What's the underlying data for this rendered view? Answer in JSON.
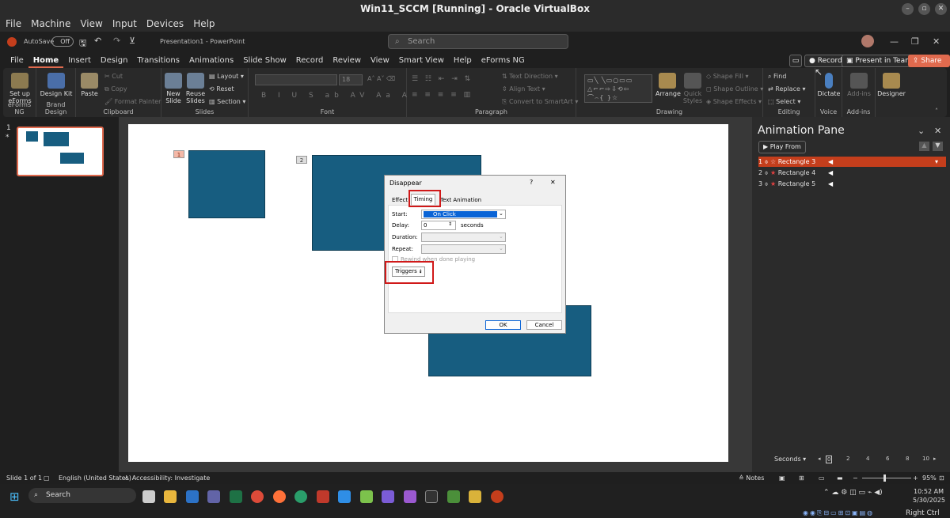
{
  "window": {
    "title": "Win11_SCCM [Running] - Oracle VirtualBox"
  },
  "vb_menu": [
    "File",
    "Machine",
    "View",
    "Input",
    "Devices",
    "Help"
  ],
  "qat": {
    "autosave": "AutoSave",
    "toggle": "Off",
    "doc_title": "Presentation1 - PowerPoint",
    "search_placeholder": "Search"
  },
  "tabs": [
    "File",
    "Home",
    "Insert",
    "Design",
    "Transitions",
    "Animations",
    "Slide Show",
    "Record",
    "Review",
    "View",
    "Smart View",
    "Help",
    "eForms NG"
  ],
  "header_buttons": {
    "record": "Record",
    "present": "Present in Teams",
    "share": "Share"
  },
  "ribbon": {
    "setup": "Set up eForms",
    "design_kit": "Design Kit",
    "g_eforms": "eForms NG",
    "g_brand": "Brand Design",
    "paste": "Paste",
    "cut": "Cut",
    "copy": "Copy",
    "format_painter": "Format Painter",
    "g_clipboard": "Clipboard",
    "new_slide": "New Slide",
    "reuse": "Reuse Slides",
    "layout": "Layout",
    "reset": "Reset",
    "section": "Section",
    "g_slides": "Slides",
    "font_size": "18",
    "g_font": "Font",
    "text_direction": "Text Direction",
    "align_text": "Align Text",
    "convert_smartart": "Convert to SmartArt",
    "g_paragraph": "Paragraph",
    "arrange": "Arrange",
    "quick_styles": "Quick Styles",
    "shape_fill": "Shape Fill",
    "shape_outline": "Shape Outline",
    "shape_effects": "Shape Effects",
    "g_drawing": "Drawing",
    "find": "Find",
    "replace": "Replace",
    "select": "Select",
    "g_editing": "Editing",
    "dictate": "Dictate",
    "g_voice": "Voice",
    "addins": "Add-ins",
    "g_addins": "Add-ins",
    "designer": "Designer"
  },
  "thumb": {
    "number": "1",
    "star": "*"
  },
  "slide": {
    "tag1": "1",
    "tag2": "2"
  },
  "animation_pane": {
    "title": "Animation Pane",
    "play_from": "Play From",
    "items": [
      {
        "num": "1",
        "label": "Rectangle 3"
      },
      {
        "num": "2",
        "label": "Rectangle 4"
      },
      {
        "num": "3",
        "label": "Rectangle 5"
      }
    ],
    "seconds": "Seconds",
    "timeline": [
      "0",
      "2",
      "4",
      "6",
      "8",
      "10"
    ]
  },
  "dialog": {
    "title": "Disappear",
    "help": "?",
    "close": "✕",
    "tabs": [
      "Effect",
      "Timing",
      "Text Animation"
    ],
    "start_label": "Start:",
    "start_value": "On Click",
    "delay_label": "Delay:",
    "delay_value": "0",
    "seconds": "seconds",
    "duration_label": "Duration:",
    "repeat_label": "Repeat:",
    "rewind": "Rewind when done playing",
    "triggers": "Triggers",
    "ok": "OK",
    "cancel": "Cancel"
  },
  "status": {
    "slide": "Slide 1 of 1",
    "language": "English (United States)",
    "accessibility": "Accessibility: Investigate",
    "notes": "Notes",
    "zoom": "95%"
  },
  "taskbar": {
    "search": "Search",
    "time": "10:52 AM",
    "date": "5/30/2025",
    "right_ctrl": "Right Ctrl"
  },
  "colors": {
    "accent": "#c43e1c",
    "shape": "#175d80",
    "highlight": "#d01919"
  }
}
